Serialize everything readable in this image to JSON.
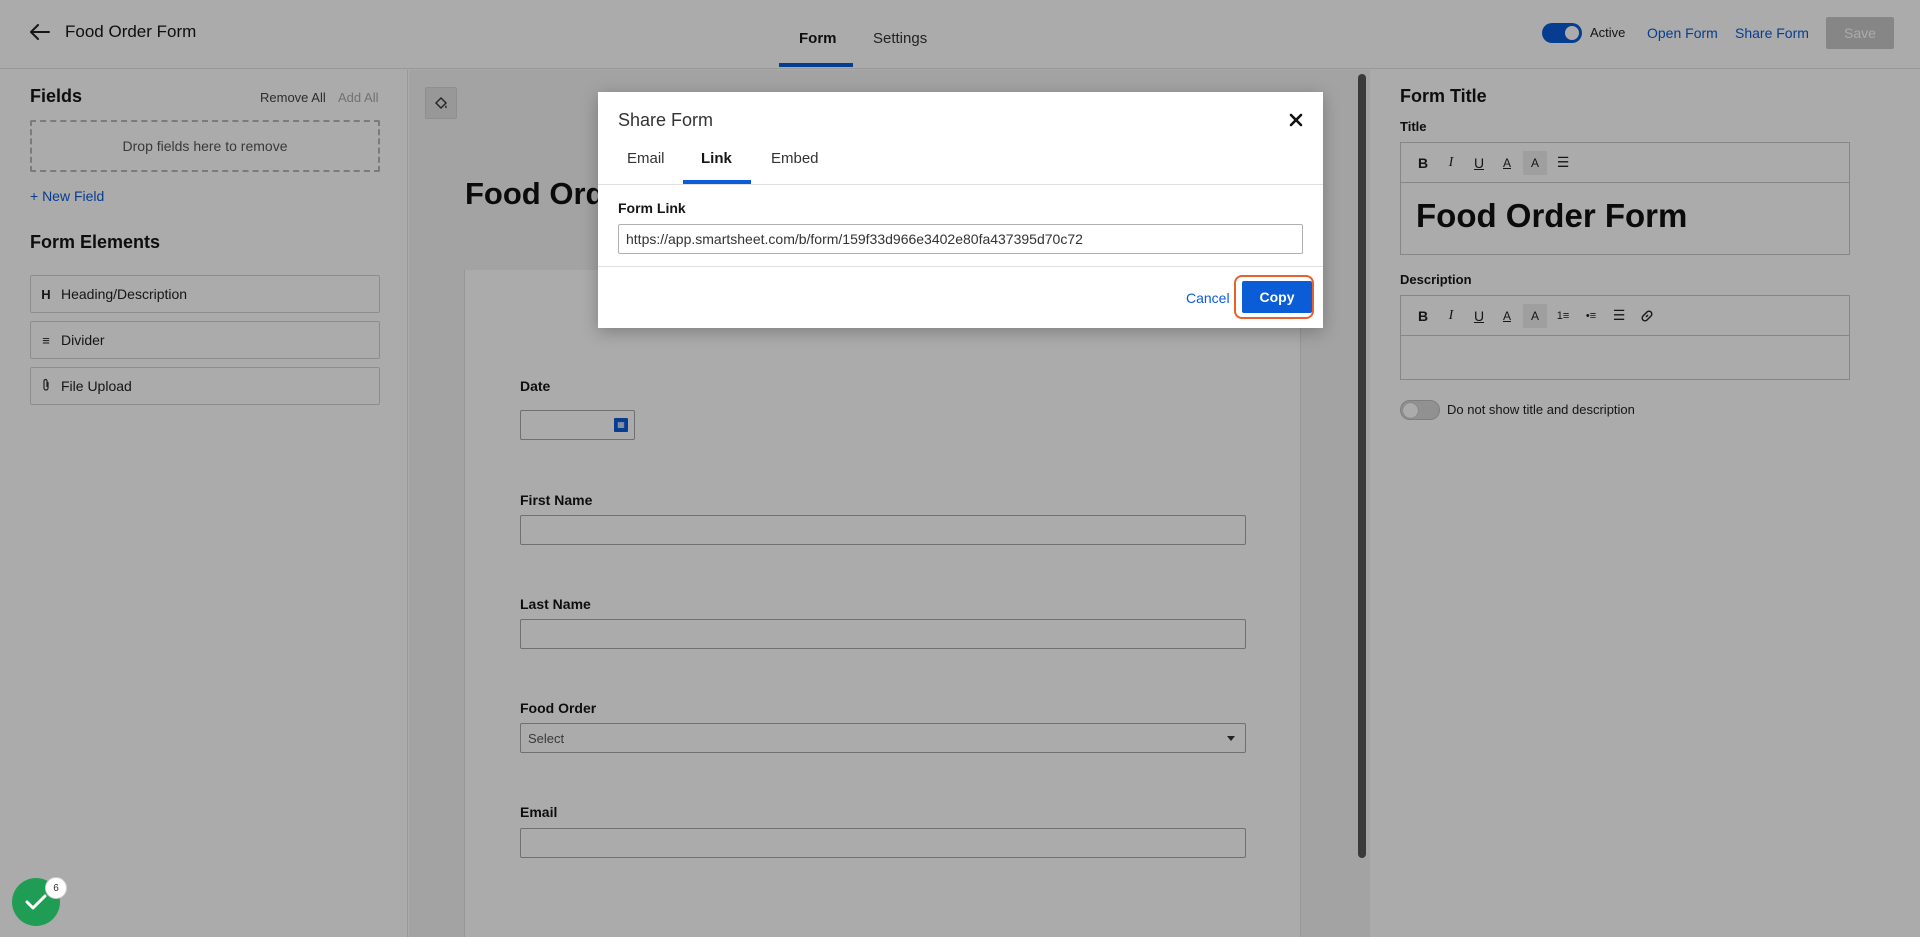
{
  "header": {
    "form_name": "Food Order Form",
    "tabs": [
      {
        "label": "Form",
        "active": true
      },
      {
        "label": "Settings",
        "active": false
      }
    ],
    "active_toggle_label": "Active",
    "active_toggle_on": true,
    "open_form_label": "Open Form",
    "share_form_label": "Share Form",
    "save_label": "Save"
  },
  "left_panel": {
    "fields_title": "Fields",
    "remove_all_label": "Remove All",
    "add_all_label": "Add All",
    "drop_zone_text": "Drop fields here to remove",
    "new_field_label": "+ New Field",
    "form_elements_title": "Form Elements",
    "elements": [
      {
        "icon": "heading-icon",
        "glyph": "H",
        "label": "Heading/Description"
      },
      {
        "icon": "divider-icon",
        "glyph": "≡",
        "label": "Divider"
      },
      {
        "icon": "paperclip-icon",
        "glyph": "⌀",
        "label": "File Upload"
      }
    ]
  },
  "canvas": {
    "form_title": "Food Order Form",
    "fields": [
      {
        "label": "Date",
        "type": "date"
      },
      {
        "label": "First Name",
        "type": "text"
      },
      {
        "label": "Last Name",
        "type": "text"
      },
      {
        "label": "Food Order",
        "type": "select",
        "placeholder": "Select"
      },
      {
        "label": "Email",
        "type": "text"
      }
    ]
  },
  "right_panel": {
    "section_title": "Form Title",
    "title_label": "Title",
    "title_value": "Food Order Form",
    "description_label": "Description",
    "description_value": "",
    "hide_toggle_label": "Do not show title and description",
    "hide_toggle_on": false
  },
  "modal": {
    "title": "Share Form",
    "tabs": [
      {
        "label": "Email",
        "active": false
      },
      {
        "label": "Link",
        "active": true
      },
      {
        "label": "Embed",
        "active": false
      }
    ],
    "link_label": "Form Link",
    "link_value": "https://app.smartsheet.com/b/form/159f33d966e3402e80fa437395d70c72",
    "cancel_label": "Cancel",
    "copy_label": "Copy"
  },
  "status_badge": {
    "count": "6"
  },
  "colors": {
    "accent": "#0b5cd7",
    "highlight_ring": "#e8602c",
    "success": "#1f9d55"
  }
}
